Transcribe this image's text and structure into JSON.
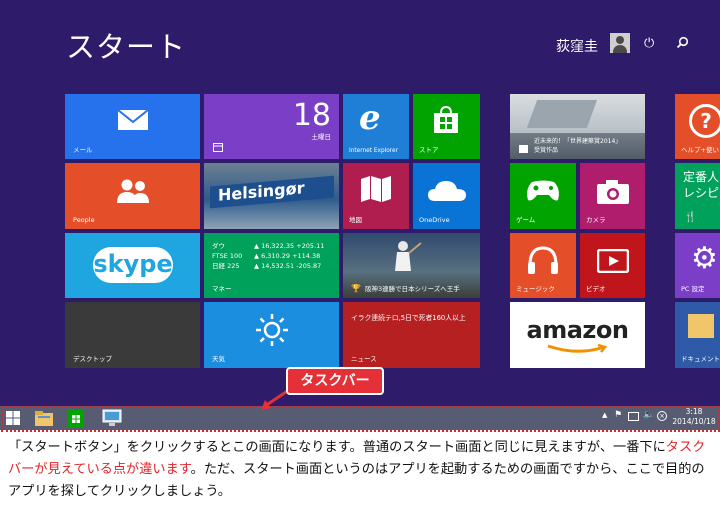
{
  "screen": {
    "title": "スタート",
    "user_name": "荻窪圭",
    "icons": [
      "power-icon",
      "search-icon"
    ]
  },
  "tiles": {
    "mail": "メール",
    "calendar_day": "18",
    "calendar_weekday": "土曜日",
    "ie": "Internet Explorer",
    "store": "ストア",
    "travel_caption_1": "近未来的！「世界建築賞2014」",
    "travel_caption_2": "受賞作品",
    "help": "ヘルプ+使い",
    "people": "People",
    "photo_sign": "Helsingør",
    "maps": "地図",
    "onedrive": "OneDrive",
    "games": "ゲーム",
    "camera": "カメラ",
    "food_1": "定番人",
    "food_2": "レシピ",
    "skype": "skype",
    "finance": [
      {
        "name": "ダウ",
        "value": "▲ 16,322.35 +205.11"
      },
      {
        "name": "FTSE 100",
        "value": "▲ 6,310.29 +114.38"
      },
      {
        "name": "日経 225",
        "value": "▲ 14,532.51 -205.87"
      }
    ],
    "money": "マネー",
    "sports": "阪神3連勝で日本シリーズへ王手",
    "music": "ミュージック",
    "video": "ビデオ",
    "pc_settings": "PC 設定",
    "desktop": "デスクトップ",
    "weather": "天気",
    "news_headline": "イラク連続テロ,5日で死者160人以上",
    "news": "ニュース",
    "amazon": "amazon",
    "documents": "ドキュメント"
  },
  "callout": "タスクバー",
  "taskbar": {
    "time": "3:18",
    "date": "2014/10/18"
  },
  "caption": {
    "part1": "「スタートボタン」をクリックするとこの画面になります。普通のスタート画面と同じに見えますが、一番下に",
    "highlight": "タスクバーが見えている点が違います",
    "part2": "。ただ、スタート画面というのはアプリを起動するための画面ですから、ここで目的のアプリを探してクリックしましょう。"
  },
  "colors": {
    "background": "#2e1c6b",
    "taskbar": "#585c72",
    "accent_red": "#e0242a"
  }
}
